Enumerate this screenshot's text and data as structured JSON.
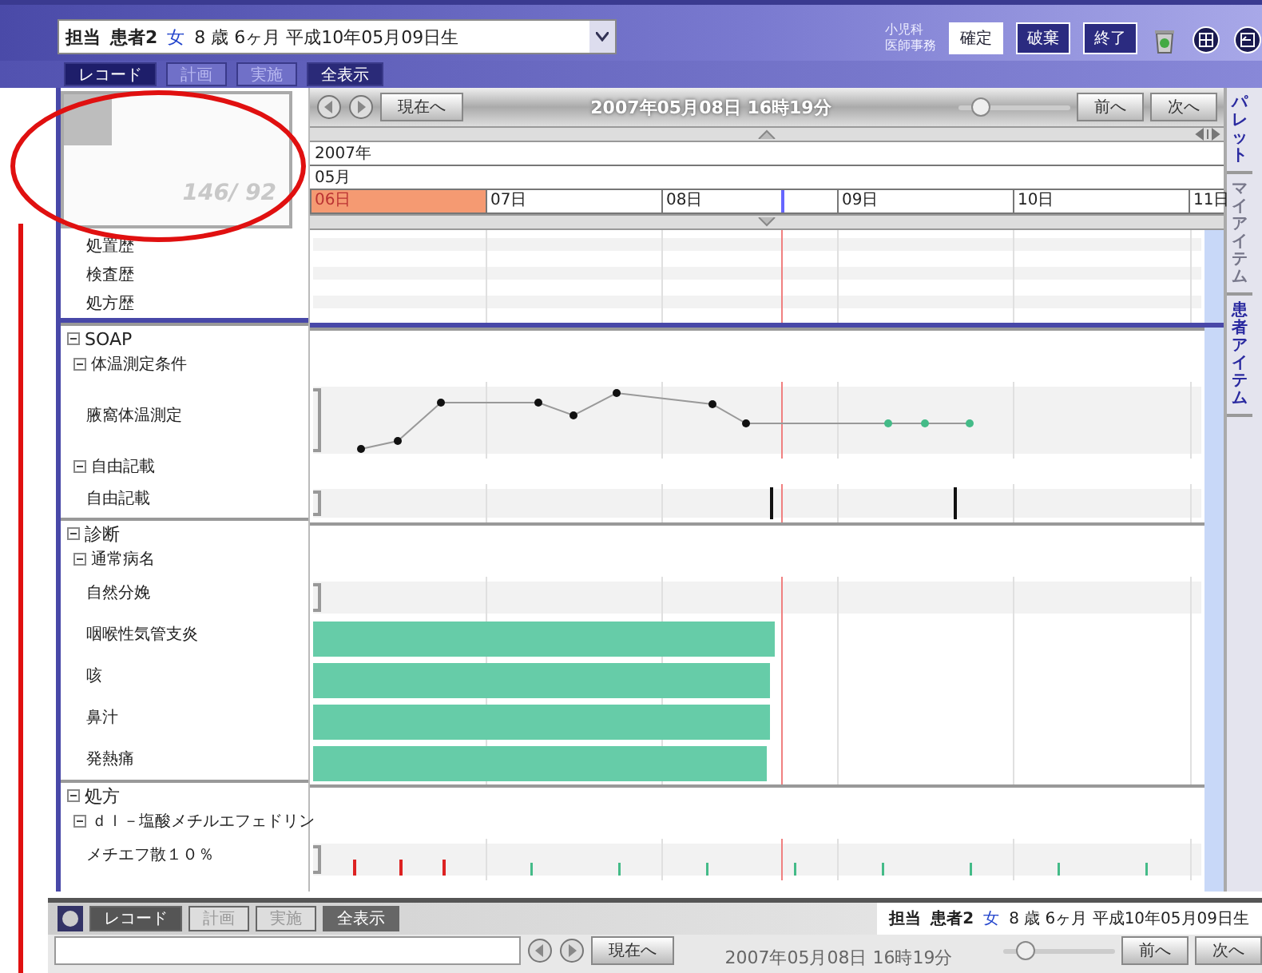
{
  "header": {
    "patient": {
      "role": "担当",
      "name": "患者2",
      "sex": "女",
      "info": "8 歳 6ヶ月 平成10年05月09日生"
    },
    "department": [
      "小児科",
      "医師事務"
    ],
    "buttons": [
      {
        "label": "確定",
        "kind": "light"
      },
      {
        "label": "破棄",
        "kind": "dark"
      },
      {
        "label": "終了",
        "kind": "dark"
      }
    ]
  },
  "tabs": [
    {
      "label": "レコード",
      "selected": true
    },
    {
      "label": "計画",
      "selected": false
    },
    {
      "label": "実施",
      "selected": false
    },
    {
      "label": "全表示",
      "selected": false
    }
  ],
  "navigator": {
    "counter": "146/ 92"
  },
  "history": [
    "処置歴",
    "検査歴",
    "処方歴"
  ],
  "timeline": {
    "now_button": "現在へ",
    "datetime": "2007年05月08日 16時19分",
    "zoom": {
      "level": 0.2
    },
    "prev": "前へ",
    "next": "次へ",
    "year": "2007年",
    "month": "05月",
    "days": [
      {
        "label": "06日",
        "selected": true
      },
      {
        "label": "07日",
        "selected": false
      },
      {
        "label": "08日",
        "selected": false
      },
      {
        "label": "09日",
        "selected": false
      },
      {
        "label": "10日",
        "selected": false
      },
      {
        "label": "11日",
        "selected": false
      }
    ]
  },
  "sections": [
    {
      "title": "SOAP",
      "expanded": true,
      "groups": [
        {
          "title": "体温測定条件",
          "expanded": true,
          "rows": [
            {
              "label": "腋窩体温測定",
              "kind": "vitals"
            }
          ]
        },
        {
          "title": "自由記載",
          "expanded": true,
          "rows": [
            {
              "label": "自由記載",
              "kind": "notes"
            }
          ]
        }
      ]
    },
    {
      "title": "診断",
      "expanded": true,
      "groups": [
        {
          "title": "通常病名",
          "expanded": true,
          "rows": [
            {
              "label": "自然分娩",
              "kind": "empty"
            },
            {
              "label": "咽喉性気管支炎",
              "kind": "bar",
              "level": 0.52
            },
            {
              "label": "咳",
              "kind": "bar",
              "level": 0.515
            },
            {
              "label": "鼻汁",
              "kind": "bar",
              "level": 0.515
            },
            {
              "label": "発熱痛",
              "kind": "bar",
              "level": 0.51
            }
          ]
        }
      ]
    },
    {
      "title": "処方",
      "expanded": true,
      "groups": [
        {
          "title": "ｄｌ－塩酸メチルエフェドリン",
          "expanded": true,
          "rows": [
            {
              "label": "メチエフ散１０％",
              "kind": "doses"
            }
          ]
        }
      ]
    }
  ],
  "sidebar": [
    {
      "label": "パレット",
      "enabled": true
    },
    {
      "label": "マイアイテム",
      "enabled": false
    },
    {
      "label": "患者アイテム",
      "enabled": true
    }
  ],
  "footer": {
    "tabs": [
      {
        "label": "レコード",
        "selected": true
      },
      {
        "label": "計画",
        "selected": false
      },
      {
        "label": "実施",
        "selected": false
      },
      {
        "label": "全表示",
        "selected": false
      }
    ],
    "patient": {
      "role": "担当",
      "name": "患者2",
      "sex": "女",
      "info": "8 歳 6ヶ月 平成10年05月09日生"
    },
    "now_button": "現在へ",
    "datetime": "2007年05月08日 16時19分",
    "zoom": {
      "level": 0.2
    },
    "prev": "前へ",
    "next": "次へ"
  }
}
